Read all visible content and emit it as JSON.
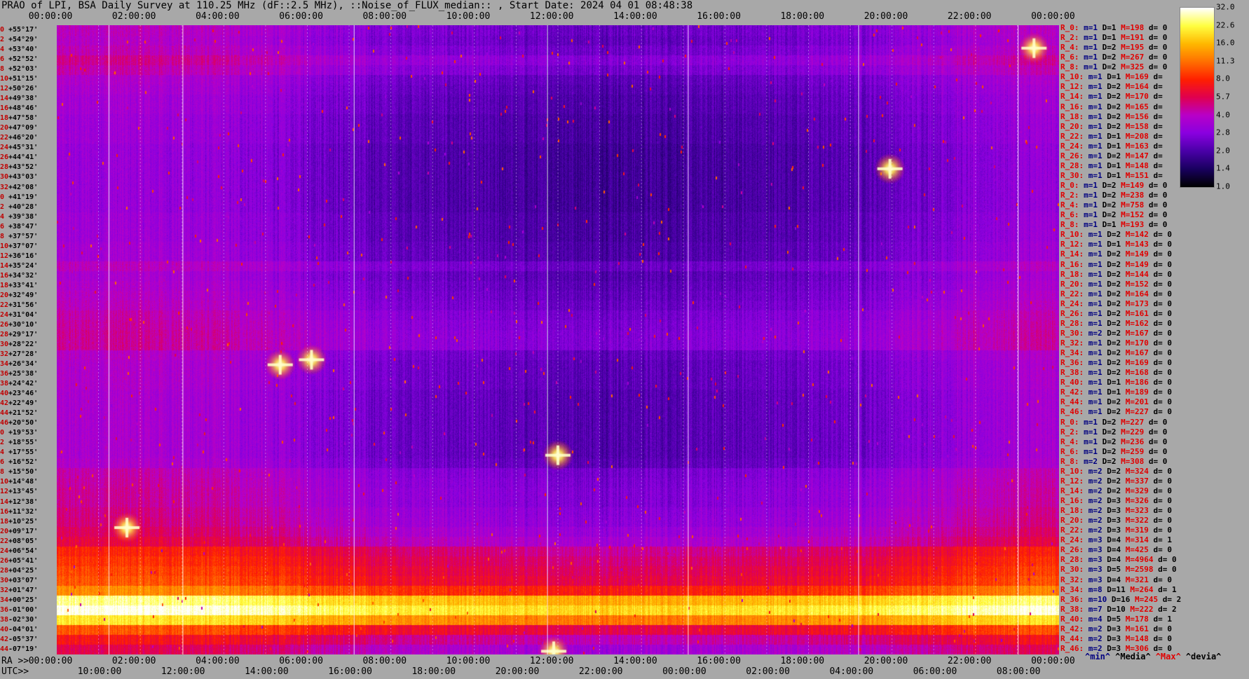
{
  "title": "PRAO of LPI, BSA Daily Survey at 110.25 MHz (dF::2.5 MHz), ::Noise_of_FLUX_median:: , Start Date: 2024 04 01 08:48:38",
  "top_axis": [
    "00:00:00",
    "02:00:00",
    "04:00:00",
    "06:00:00",
    "08:00:00",
    "10:00:00",
    "12:00:00",
    "14:00:00",
    "16:00:00",
    "18:00:00",
    "20:00:00",
    "22:00:00",
    "00:00:00"
  ],
  "ra_axis": {
    "prefix": "RA >>",
    "labels": [
      "00:00:00",
      "02:00:00",
      "04:00:00",
      "06:00:00",
      "08:00:00",
      "10:00:00",
      "12:00:00",
      "14:00:00",
      "16:00:00",
      "18:00:00",
      "20:00:00",
      "22:00:00",
      "00:00:00"
    ]
  },
  "utc_axis": {
    "prefix": "UTC>>",
    "labels": [
      "10:00:00",
      "12:00:00",
      "14:00:00",
      "16:00:00",
      "18:00:00",
      "20:00:00",
      "22:00:00",
      "00:00:00",
      "02:00:00",
      "04:00:00",
      "06:00:00",
      "08:00:00"
    ]
  },
  "declinations": [
    {
      "i": "0",
      "v": "+55°17'"
    },
    {
      "i": "2",
      "v": "+54°29'"
    },
    {
      "i": "4",
      "v": "+53°40'"
    },
    {
      "i": "6",
      "v": "+52°52'"
    },
    {
      "i": "8",
      "v": "+52°03'"
    },
    {
      "i": "10",
      "v": "+51°15'"
    },
    {
      "i": "12",
      "v": "+50°26'"
    },
    {
      "i": "14",
      "v": "+49°38'"
    },
    {
      "i": "16",
      "v": "+48°46'"
    },
    {
      "i": "18",
      "v": "+47°58'"
    },
    {
      "i": "20",
      "v": "+47°09'"
    },
    {
      "i": "22",
      "v": "+46°20'"
    },
    {
      "i": "24",
      "v": "+45°31'"
    },
    {
      "i": "26",
      "v": "+44°41'"
    },
    {
      "i": "28",
      "v": "+43°52'"
    },
    {
      "i": "30",
      "v": "+43°03'"
    },
    {
      "i": "32",
      "v": "+42°08'"
    },
    {
      "i": "0",
      "v": "+41°19'"
    },
    {
      "i": "2",
      "v": "+40°28'"
    },
    {
      "i": "4",
      "v": "+39°38'"
    },
    {
      "i": "6",
      "v": "+38°47'"
    },
    {
      "i": "8",
      "v": "+37°57'"
    },
    {
      "i": "10",
      "v": "+37°07'"
    },
    {
      "i": "12",
      "v": "+36°16'"
    },
    {
      "i": "14",
      "v": "+35°24'"
    },
    {
      "i": "16",
      "v": "+34°32'"
    },
    {
      "i": "18",
      "v": "+33°41'"
    },
    {
      "i": "20",
      "v": "+32°49'"
    },
    {
      "i": "22",
      "v": "+31°56'"
    },
    {
      "i": "24",
      "v": "+31°04'"
    },
    {
      "i": "26",
      "v": "+30°10'"
    },
    {
      "i": "28",
      "v": "+29°17'"
    },
    {
      "i": "30",
      "v": "+28°22'"
    },
    {
      "i": "32",
      "v": "+27°28'"
    },
    {
      "i": "34",
      "v": "+26°34'"
    },
    {
      "i": "36",
      "v": "+25°38'"
    },
    {
      "i": "38",
      "v": "+24°42'"
    },
    {
      "i": "40",
      "v": "+23°46'"
    },
    {
      "i": "42",
      "v": "+22°49'"
    },
    {
      "i": "44",
      "v": "+21°52'"
    },
    {
      "i": "46",
      "v": "+20°50'"
    },
    {
      "i": "0",
      "v": "+19°53'"
    },
    {
      "i": "2",
      "v": "+18°55'"
    },
    {
      "i": "4",
      "v": "+17°55'"
    },
    {
      "i": "6",
      "v": "+16°52'"
    },
    {
      "i": "8",
      "v": "+15°50'"
    },
    {
      "i": "10",
      "v": "+14°48'"
    },
    {
      "i": "12",
      "v": "+13°45'"
    },
    {
      "i": "14",
      "v": "+12°38'"
    },
    {
      "i": "16",
      "v": "+11°32'"
    },
    {
      "i": "18",
      "v": "+10°25'"
    },
    {
      "i": "20",
      "v": "+09°17'"
    },
    {
      "i": "22",
      "v": "+08°05'"
    },
    {
      "i": "24",
      "v": "+06°54'"
    },
    {
      "i": "26",
      "v": "+05°41'"
    },
    {
      "i": "28",
      "v": "+04°25'"
    },
    {
      "i": "30",
      "v": "+03°07'"
    },
    {
      "i": "32",
      "v": "+01°47'"
    },
    {
      "i": "34",
      "v": "+00°25'"
    },
    {
      "i": "36",
      "v": "-01°00'"
    },
    {
      "i": "38",
      "v": "-02°30'"
    },
    {
      "i": "40",
      "v": "-04°01'"
    },
    {
      "i": "42",
      "v": "-05°37'"
    },
    {
      "i": "44",
      "v": "-07°19'"
    }
  ],
  "stats": [
    {
      "r": "R_0:",
      "m": "m=1",
      "d": "D=1",
      "M": "M=198",
      "dv": "d= 0"
    },
    {
      "r": "R_2:",
      "m": "m=1",
      "d": "D=1",
      "M": "M=191",
      "dv": "d= 0"
    },
    {
      "r": "R_4:",
      "m": "m=1",
      "d": "D=2",
      "M": "M=195",
      "dv": "d= 0"
    },
    {
      "r": "R_6:",
      "m": "m=1",
      "d": "D=2",
      "M": "M=267",
      "dv": "d= 0"
    },
    {
      "r": "R_8:",
      "m": "m=1",
      "d": "D=2",
      "M": "M=325",
      "dv": "d= 0"
    },
    {
      "r": "R_10:",
      "m": "m=1",
      "d": "D=1",
      "M": "M=169",
      "dv": "d="
    },
    {
      "r": "R_12:",
      "m": "m=1",
      "d": "D=2",
      "M": "M=164",
      "dv": "d="
    },
    {
      "r": "R_14:",
      "m": "m=1",
      "d": "D=2",
      "M": "M=170",
      "dv": "d="
    },
    {
      "r": "R_16:",
      "m": "m=1",
      "d": "D=2",
      "M": "M=165",
      "dv": "d="
    },
    {
      "r": "R_18:",
      "m": "m=1",
      "d": "D=2",
      "M": "M=156",
      "dv": "d="
    },
    {
      "r": "R_20:",
      "m": "m=1",
      "d": "D=2",
      "M": "M=158",
      "dv": "d="
    },
    {
      "r": "R_22:",
      "m": "m=1",
      "d": "D=1",
      "M": "M=208",
      "dv": "d="
    },
    {
      "r": "R_24:",
      "m": "m=1",
      "d": "D=1",
      "M": "M=163",
      "dv": "d="
    },
    {
      "r": "R_26:",
      "m": "m=1",
      "d": "D=2",
      "M": "M=147",
      "dv": "d="
    },
    {
      "r": "R_28:",
      "m": "m=1",
      "d": "D=1",
      "M": "M=148",
      "dv": "d="
    },
    {
      "r": "R_30:",
      "m": "m=1",
      "d": "D=1",
      "M": "M=151",
      "dv": "d="
    },
    {
      "r": "R_0:",
      "m": "m=1",
      "d": "D=2",
      "M": "M=149",
      "dv": "d= 0"
    },
    {
      "r": "R_2:",
      "m": "m=1",
      "d": "D=2",
      "M": "M=238",
      "dv": "d= 0"
    },
    {
      "r": "R_4:",
      "m": "m=1",
      "d": "D=2",
      "M": "M=758",
      "dv": "d= 0"
    },
    {
      "r": "R_6:",
      "m": "m=1",
      "d": "D=2",
      "M": "M=152",
      "dv": "d= 0"
    },
    {
      "r": "R_8:",
      "m": "m=1",
      "d": "D=1",
      "M": "M=193",
      "dv": "d= 0"
    },
    {
      "r": "R_10:",
      "m": "m=1",
      "d": "D=2",
      "M": "M=142",
      "dv": "d= 0"
    },
    {
      "r": "R_12:",
      "m": "m=1",
      "d": "D=1",
      "M": "M=143",
      "dv": "d= 0"
    },
    {
      "r": "R_14:",
      "m": "m=1",
      "d": "D=2",
      "M": "M=149",
      "dv": "d= 0"
    },
    {
      "r": "R_16:",
      "m": "m=1",
      "d": "D=2",
      "M": "M=149",
      "dv": "d= 0"
    },
    {
      "r": "R_18:",
      "m": "m=1",
      "d": "D=2",
      "M": "M=144",
      "dv": "d= 0"
    },
    {
      "r": "R_20:",
      "m": "m=1",
      "d": "D=2",
      "M": "M=152",
      "dv": "d= 0"
    },
    {
      "r": "R_22:",
      "m": "m=1",
      "d": "D=2",
      "M": "M=164",
      "dv": "d= 0"
    },
    {
      "r": "R_24:",
      "m": "m=1",
      "d": "D=2",
      "M": "M=173",
      "dv": "d= 0"
    },
    {
      "r": "R_26:",
      "m": "m=1",
      "d": "D=2",
      "M": "M=161",
      "dv": "d= 0"
    },
    {
      "r": "R_28:",
      "m": "m=1",
      "d": "D=2",
      "M": "M=162",
      "dv": "d= 0"
    },
    {
      "r": "R_30:",
      "m": "m=2",
      "d": "D=2",
      "M": "M=167",
      "dv": "d= 0"
    },
    {
      "r": "R_32:",
      "m": "m=1",
      "d": "D=2",
      "M": "M=170",
      "dv": "d= 0"
    },
    {
      "r": "R_34:",
      "m": "m=1",
      "d": "D=2",
      "M": "M=167",
      "dv": "d= 0"
    },
    {
      "r": "R_36:",
      "m": "m=1",
      "d": "D=2",
      "M": "M=169",
      "dv": "d= 0"
    },
    {
      "r": "R_38:",
      "m": "m=1",
      "d": "D=2",
      "M": "M=168",
      "dv": "d= 0"
    },
    {
      "r": "R_40:",
      "m": "m=1",
      "d": "D=1",
      "M": "M=186",
      "dv": "d= 0"
    },
    {
      "r": "R_42:",
      "m": "m=1",
      "d": "D=1",
      "M": "M=189",
      "dv": "d= 0"
    },
    {
      "r": "R_44:",
      "m": "m=1",
      "d": "D=2",
      "M": "M=201",
      "dv": "d= 0"
    },
    {
      "r": "R_46:",
      "m": "m=1",
      "d": "D=2",
      "M": "M=227",
      "dv": "d= 0"
    },
    {
      "r": "R_0:",
      "m": "m=1",
      "d": "D=2",
      "M": "M=227",
      "dv": "d= 0"
    },
    {
      "r": "R_2:",
      "m": "m=1",
      "d": "D=2",
      "M": "M=229",
      "dv": "d= 0"
    },
    {
      "r": "R_4:",
      "m": "m=1",
      "d": "D=2",
      "M": "M=236",
      "dv": "d= 0"
    },
    {
      "r": "R_6:",
      "m": "m=1",
      "d": "D=2",
      "M": "M=259",
      "dv": "d= 0"
    },
    {
      "r": "R_8:",
      "m": "m=2",
      "d": "D=2",
      "M": "M=308",
      "dv": "d= 0"
    },
    {
      "r": "R_10:",
      "m": "m=2",
      "d": "D=2",
      "M": "M=324",
      "dv": "d= 0"
    },
    {
      "r": "R_12:",
      "m": "m=2",
      "d": "D=2",
      "M": "M=337",
      "dv": "d= 0"
    },
    {
      "r": "R_14:",
      "m": "m=2",
      "d": "D=2",
      "M": "M=329",
      "dv": "d= 0"
    },
    {
      "r": "R_16:",
      "m": "m=2",
      "d": "D=3",
      "M": "M=326",
      "dv": "d= 0"
    },
    {
      "r": "R_18:",
      "m": "m=2",
      "d": "D=3",
      "M": "M=323",
      "dv": "d= 0"
    },
    {
      "r": "R_20:",
      "m": "m=2",
      "d": "D=3",
      "M": "M=322",
      "dv": "d= 0"
    },
    {
      "r": "R_22:",
      "m": "m=2",
      "d": "D=3",
      "M": "M=319",
      "dv": "d= 0"
    },
    {
      "r": "R_24:",
      "m": "m=3",
      "d": "D=4",
      "M": "M=314",
      "dv": "d= 1"
    },
    {
      "r": "R_26:",
      "m": "m=3",
      "d": "D=4",
      "M": "M=425",
      "dv": "d= 0"
    },
    {
      "r": "R_28:",
      "m": "m=3",
      "d": "D=4",
      "M": "M=4964",
      "dv": "d= 0"
    },
    {
      "r": "R_30:",
      "m": "m=3",
      "d": "D=5",
      "M": "M=2598",
      "dv": "d= 0"
    },
    {
      "r": "R_32:",
      "m": "m=3",
      "d": "D=4",
      "M": "M=321",
      "dv": "d= 0"
    },
    {
      "r": "R_34:",
      "m": "m=8",
      "d": "D=11",
      "M": "M=264",
      "dv": "d= 1"
    },
    {
      "r": "R_36:",
      "m": "m=10",
      "d": "D=16",
      "M": "M=245",
      "dv": "d= 2"
    },
    {
      "r": "R_38:",
      "m": "m=7",
      "d": "D=10",
      "M": "M=222",
      "dv": "d= 2"
    },
    {
      "r": "R_40:",
      "m": "m=4",
      "d": "D=5",
      "M": "M=178",
      "dv": "d= 1"
    },
    {
      "r": "R_42:",
      "m": "m=2",
      "d": "D=3",
      "M": "M=161",
      "dv": "d= 0"
    },
    {
      "r": "R_44:",
      "m": "m=2",
      "d": "D=3",
      "M": "M=148",
      "dv": "d= 0"
    },
    {
      "r": "R_46:",
      "m": "m=2",
      "d": "D=3",
      "M": "M=306",
      "dv": "d= 0"
    }
  ],
  "legend_bottom": [
    {
      "text": "^min^",
      "color": "#000080"
    },
    {
      "text": "^Media^",
      "color": "#000000"
    },
    {
      "text": "^Max^",
      "color": "#e00000"
    },
    {
      "text": "^devia^",
      "color": "#000000"
    }
  ],
  "colorbar": {
    "labels": [
      "32.0",
      "22.6",
      "16.0",
      "11.3",
      "8.0",
      "5.7",
      "4.0",
      "2.8",
      "2.0",
      "1.4",
      "1.0"
    ],
    "colormap": [
      "#000000",
      "#1a0060",
      "#4a00a8",
      "#8a00e0",
      "#b800c8",
      "#e00050",
      "#ff2000",
      "#ff7000",
      "#ffb800",
      "#ffff40",
      "#ffffff"
    ]
  },
  "chart_data": {
    "type": "heatmap",
    "title": "PRAO of LPI, BSA Daily Survey at 110.25 MHz (dF::2.5 MHz), ::Noise_of_FLUX_median:: , Start Date: 2024 04 01 08:48:38",
    "x_ra_hours": [
      0,
      24
    ],
    "y_dec_deg": [
      55.28,
      -7.32
    ],
    "value_range": [
      1.0,
      32.0
    ],
    "log_scale": true,
    "rows": 64,
    "row_levels": [
      2.8,
      2.7,
      2.9,
      3.3,
      3.0,
      2.6,
      2.5,
      2.4,
      2.4,
      2.3,
      2.3,
      2.3,
      2.2,
      2.2,
      2.2,
      2.2,
      2.2,
      2.2,
      2.2,
      2.3,
      2.3,
      2.3,
      2.4,
      2.4,
      2.8,
      2.5,
      2.6,
      2.7,
      2.8,
      3.0,
      3.1,
      3.2,
      3.2,
      2.7,
      2.6,
      2.6,
      2.6,
      2.5,
      2.5,
      2.5,
      2.5,
      2.5,
      2.5,
      2.5,
      2.6,
      3.0,
      3.1,
      3.2,
      3.2,
      3.4,
      3.5,
      3.8,
      4.2,
      5.5,
      6.0,
      6.5,
      7.0,
      9.0,
      18.0,
      22.0,
      14.0,
      7.0,
      5.0,
      4.0
    ],
    "bright_sources": [
      {
        "ra": 1.68,
        "dec": 5.3,
        "peak": 32
      },
      {
        "ra": 19.95,
        "dec": 41.0,
        "peak": 32
      },
      {
        "ra": 11.9,
        "dec": -7.0,
        "peak": 32
      },
      {
        "ra": 23.4,
        "dec": 53.0,
        "peak": 24
      },
      {
        "ra": 12.0,
        "dec": 12.5,
        "peak": 20
      },
      {
        "ra": 5.35,
        "dec": 21.5,
        "peak": 16
      },
      {
        "ra": 6.1,
        "dec": 22.0,
        "peak": 14
      }
    ],
    "vertical_markers_ra": [
      1.25,
      3.02,
      7.12,
      11.75,
      15.12,
      19.2,
      23.02
    ]
  }
}
